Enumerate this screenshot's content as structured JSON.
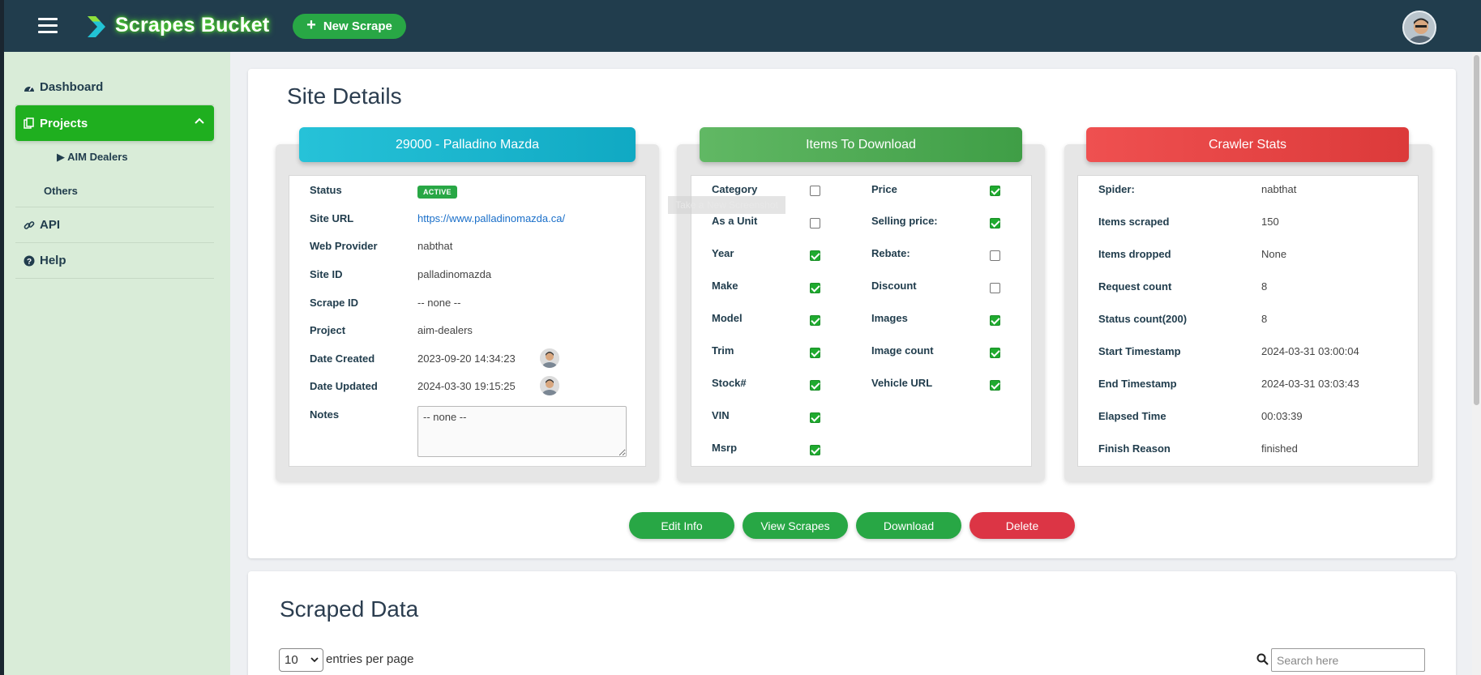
{
  "topbar": {
    "brand": "Scrapes Bucket",
    "new_scrape_label": "New Scrape"
  },
  "sidebar": {
    "items": [
      {
        "label": "Dashboard"
      },
      {
        "label": "Projects"
      },
      {
        "label": "API"
      },
      {
        "label": "Help"
      }
    ],
    "sub_items": [
      {
        "label": "▶ AIM Dealers"
      },
      {
        "label": "Others"
      }
    ]
  },
  "site_details": {
    "title": "Site Details",
    "card_title": "29000 - Palladino Mazda",
    "status_label": "Status",
    "status_badge": "ACTIVE",
    "fields": [
      {
        "label": "Site URL",
        "value": "https://www.palladinomazda.ca/"
      },
      {
        "label": "Web Provider",
        "value": "nabthat"
      },
      {
        "label": "Site ID",
        "value": "palladinomazda"
      },
      {
        "label": "Scrape ID",
        "value": "-- none --"
      },
      {
        "label": "Project",
        "value": "aim-dealers"
      },
      {
        "label": "Date Created",
        "value": "2023-09-20 14:34:23"
      },
      {
        "label": "Date Updated",
        "value": "2024-03-30 19:15:25"
      }
    ],
    "notes_label": "Notes",
    "notes_value": "-- none --"
  },
  "items_to_download": {
    "title": "Items To Download",
    "tooltip": "Take a New Screenshot",
    "left": [
      {
        "label": "Category",
        "checked": false
      },
      {
        "label": "As a Unit",
        "checked": false
      },
      {
        "label": "Year",
        "checked": true
      },
      {
        "label": "Make",
        "checked": true
      },
      {
        "label": "Model",
        "checked": true
      },
      {
        "label": "Trim",
        "checked": true
      },
      {
        "label": "Stock#",
        "checked": true
      },
      {
        "label": "VIN",
        "checked": true
      },
      {
        "label": "Msrp",
        "checked": true
      }
    ],
    "right": [
      {
        "label": "Price",
        "checked": true
      },
      {
        "label": "Selling price:",
        "checked": true
      },
      {
        "label": "Rebate:",
        "checked": false
      },
      {
        "label": "Discount",
        "checked": false
      },
      {
        "label": "Images",
        "checked": true
      },
      {
        "label": "Image count",
        "checked": true
      },
      {
        "label": "Vehicle URL",
        "checked": true
      }
    ]
  },
  "crawler_stats": {
    "title": "Crawler Stats",
    "rows": [
      {
        "label": "Spider:",
        "value": "nabthat"
      },
      {
        "label": "Items scraped",
        "value": "150"
      },
      {
        "label": "Items dropped",
        "value": "None"
      },
      {
        "label": "Request count",
        "value": "8"
      },
      {
        "label": "Status count(200)",
        "value": "8"
      },
      {
        "label": "Start Timestamp",
        "value": "2024-03-31 03:00:04"
      },
      {
        "label": "End Timestamp",
        "value": "2024-03-31 03:03:43"
      },
      {
        "label": "Elapsed Time",
        "value": "00:03:39"
      },
      {
        "label": "Finish Reason",
        "value": "finished"
      }
    ]
  },
  "actions": {
    "edit": "Edit Info",
    "view": "View Scrapes",
    "download": "Download",
    "delete": "Delete"
  },
  "scraped_data": {
    "title": "Scraped Data",
    "entries_value": "10",
    "entries_label": "entries per page",
    "search_placeholder": "Search here"
  },
  "colors": {
    "topbar": "#213d4d",
    "sidebar": "#d9ecd8",
    "active_nav": "#1faf1f",
    "site_card_header": "#1fb8cf",
    "items_card_header": "#4caf50",
    "stats_card_header": "#e84545",
    "primary_button": "#28a745",
    "danger_button": "#dc3545"
  }
}
